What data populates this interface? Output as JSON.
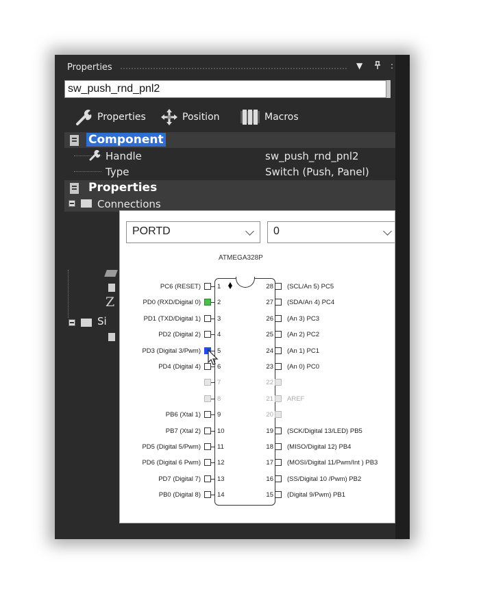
{
  "panel": {
    "title": "Properties",
    "controls": {
      "dropdown": "▼",
      "pin": "ᵖ",
      "close": ":"
    },
    "component_name": "sw_push_rnd_pnl2",
    "tabs": [
      {
        "label": "Properties",
        "icon": "wrench-icon"
      },
      {
        "label": "Position",
        "icon": "move-arrows-icon"
      },
      {
        "label": "Macros",
        "icon": "macros-icon"
      }
    ]
  },
  "grid": {
    "component": {
      "label": "Component",
      "rows": [
        {
          "name": "Handle",
          "value": "sw_push_rnd_pnl2"
        },
        {
          "name": "Type",
          "value": "Switch (Push, Panel)"
        }
      ]
    },
    "properties": {
      "label": "Properties",
      "connections_label": "Connections",
      "sim_label": "Si",
      "z_label": "Z"
    }
  },
  "popup": {
    "port_select": "PORTD",
    "bit_select": "0",
    "chip_name": "ATMEGA328P",
    "left_pins": [
      {
        "num": "1",
        "label": "PC6 (RESET)",
        "state": "normal"
      },
      {
        "num": "2",
        "label": "PD0 (RXD/Digital 0)",
        "state": "green"
      },
      {
        "num": "3",
        "label": "PD1 (TXD/Digital 1)",
        "state": "normal"
      },
      {
        "num": "4",
        "label": "PD2 (Digital 2)",
        "state": "normal"
      },
      {
        "num": "5",
        "label": "PD3 (Digital 3/Pwm)",
        "state": "blue"
      },
      {
        "num": "6",
        "label": "PD4 (Digital 4)",
        "state": "normal"
      },
      {
        "num": "7",
        "label": "",
        "state": "dim"
      },
      {
        "num": "8",
        "label": "",
        "state": "dim"
      },
      {
        "num": "9",
        "label": "PB6 (Xtal 1)",
        "state": "normal"
      },
      {
        "num": "10",
        "label": "PB7 (Xtal 2)",
        "state": "normal"
      },
      {
        "num": "11",
        "label": "PD5 (Digital 5/Pwm)",
        "state": "normal"
      },
      {
        "num": "12",
        "label": "PD6 (Digital 6 Pwm)",
        "state": "normal"
      },
      {
        "num": "13",
        "label": "PD7 (Digital 7)",
        "state": "normal"
      },
      {
        "num": "14",
        "label": "PB0 (Digital 8)",
        "state": "normal"
      }
    ],
    "right_pins": [
      {
        "num": "28",
        "label": "(SCL/An 5) PC5",
        "state": "normal"
      },
      {
        "num": "27",
        "label": "(SDA/An 4) PC4",
        "state": "normal"
      },
      {
        "num": "26",
        "label": "(An 3) PC3",
        "state": "normal"
      },
      {
        "num": "25",
        "label": "(An 2) PC2",
        "state": "normal"
      },
      {
        "num": "24",
        "label": "(An 1) PC1",
        "state": "normal"
      },
      {
        "num": "23",
        "label": "(An 0) PC0",
        "state": "normal"
      },
      {
        "num": "22",
        "label": "",
        "state": "dim"
      },
      {
        "num": "21",
        "label": "AREF",
        "state": "dim"
      },
      {
        "num": "20",
        "label": "",
        "state": "dim"
      },
      {
        "num": "19",
        "label": "(SCK/Digital 13/LED) PB5",
        "state": "normal"
      },
      {
        "num": "18",
        "label": "(MISO/Digital 12) PB4",
        "state": "normal"
      },
      {
        "num": "17",
        "label": "(MOSI/Digital 11/Pwm/Int ) PB3",
        "state": "normal"
      },
      {
        "num": "16",
        "label": "(SS/Digital 10 /Pwm) PB2",
        "state": "normal"
      },
      {
        "num": "15",
        "label": "(Digital 9/Pwm) PB1",
        "state": "normal"
      }
    ]
  }
}
